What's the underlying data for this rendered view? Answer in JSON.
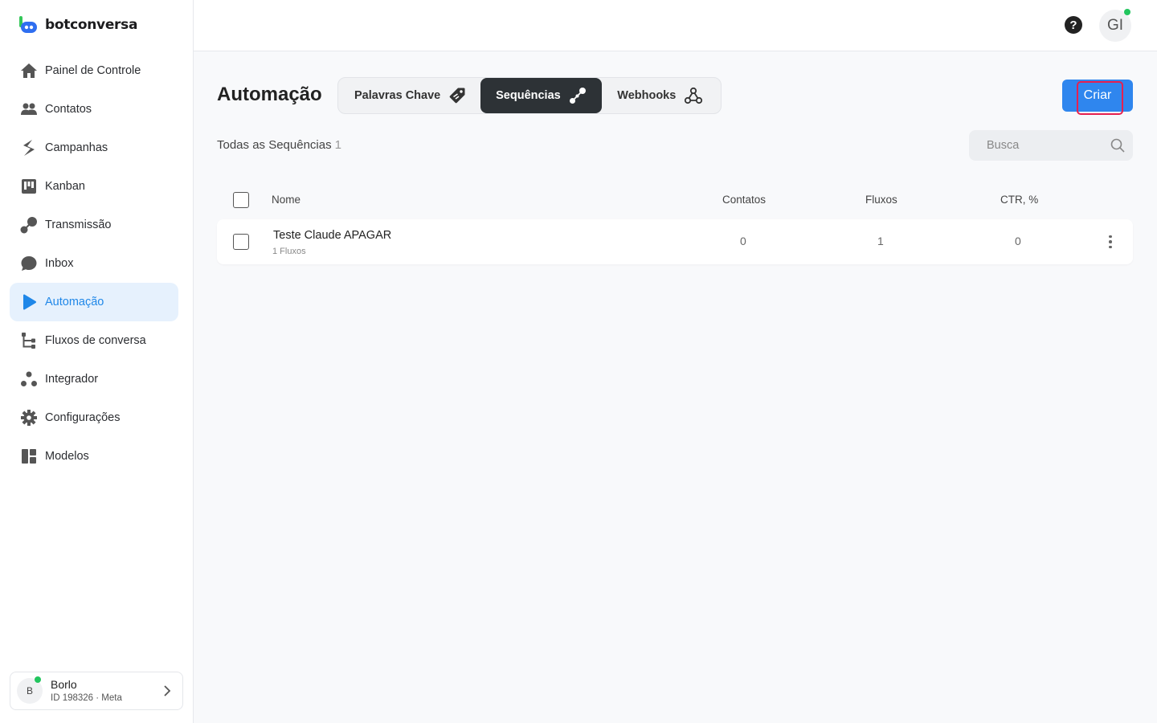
{
  "app": {
    "name": "botconversa"
  },
  "sidebar": {
    "items": [
      {
        "label": "Painel de Controle",
        "icon": "home-icon"
      },
      {
        "label": "Contatos",
        "icon": "users-icon"
      },
      {
        "label": "Campanhas",
        "icon": "campaigns-icon"
      },
      {
        "label": "Kanban",
        "icon": "kanban-icon"
      },
      {
        "label": "Transmissão",
        "icon": "broadcast-icon"
      },
      {
        "label": "Inbox",
        "icon": "chat-bubble-icon"
      },
      {
        "label": "Automação",
        "icon": "automation-play-icon",
        "active": true
      },
      {
        "label": "Fluxos de conversa",
        "icon": "flow-tree-icon"
      },
      {
        "label": "Integrador",
        "icon": "integrator-icon"
      },
      {
        "label": "Configurações",
        "icon": "gear-icon"
      },
      {
        "label": "Modelos",
        "icon": "templates-icon"
      }
    ],
    "account": {
      "initial": "B",
      "name": "Borlo",
      "sub": "ID 198326 · Meta",
      "online": true
    }
  },
  "topbar": {
    "help": "?",
    "user_initials": "GI",
    "online": true
  },
  "main": {
    "title": "Automação",
    "tabs": [
      {
        "label": "Palavras Chave",
        "icon": "tag-icon"
      },
      {
        "label": "Sequências",
        "icon": "sequence-icon",
        "active": true
      },
      {
        "label": "Webhooks",
        "icon": "webhook-icon"
      }
    ],
    "create_label": "Criar",
    "subheading": "Todas as Sequências",
    "subheading_count": "1",
    "search_placeholder": "Busca",
    "table": {
      "columns": [
        "Nome",
        "Contatos",
        "Fluxos",
        "CTR, %"
      ],
      "rows": [
        {
          "name": "Teste Claude APAGAR",
          "flows_label": "1 Fluxos",
          "contatos": "0",
          "fluxos": "1",
          "ctr": "0"
        }
      ]
    }
  },
  "colors": {
    "accent": "#2f86ee",
    "active_nav_bg": "#e6f1fd",
    "active_tab_bg": "#2d3236",
    "highlight": "#e6204f",
    "online": "#22c55e"
  }
}
